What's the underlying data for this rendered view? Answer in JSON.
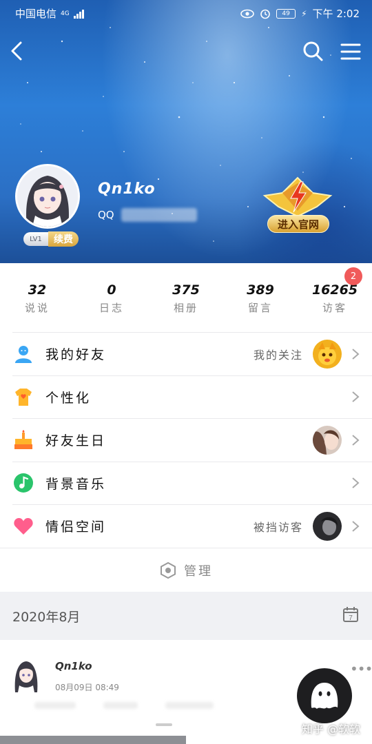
{
  "status_bar": {
    "carrier": "中国电信",
    "network": "4G",
    "battery": "49",
    "time": "下午 2:02"
  },
  "profile": {
    "nickname": "Qn1ko",
    "qq_prefix": "QQ",
    "level": "LV1",
    "renew_label": "续费",
    "vip_label": "进入官网"
  },
  "stats": [
    {
      "num": "32",
      "label": "说说"
    },
    {
      "num": "0",
      "label": "日志"
    },
    {
      "num": "375",
      "label": "相册"
    },
    {
      "num": "389",
      "label": "留言"
    },
    {
      "num": "16265",
      "label": "访客",
      "badge": "2"
    }
  ],
  "menu": [
    {
      "label": "我的好友",
      "hint": "我的关注",
      "icon": "friend-icon",
      "color": "#3aa6f4"
    },
    {
      "label": "个性化",
      "hint": "",
      "icon": "tshirt-icon",
      "color": "#ffb52b"
    },
    {
      "label": "好友生日",
      "hint": "",
      "icon": "cake-icon",
      "color": "#ff9a2b"
    },
    {
      "label": "背景音乐",
      "hint": "",
      "icon": "music-icon",
      "color": "#2ac46b"
    },
    {
      "label": "情侣空间",
      "hint": "被挡访客",
      "icon": "heart-icon",
      "color": "#ff5e8c"
    }
  ],
  "manage_label": "管理",
  "month": "2020年8月",
  "calendar_day": "7",
  "post": {
    "name": "Qn1ko",
    "time": "08月09日 08:49",
    "more": "•••"
  },
  "watermark": "知乎 @软软"
}
